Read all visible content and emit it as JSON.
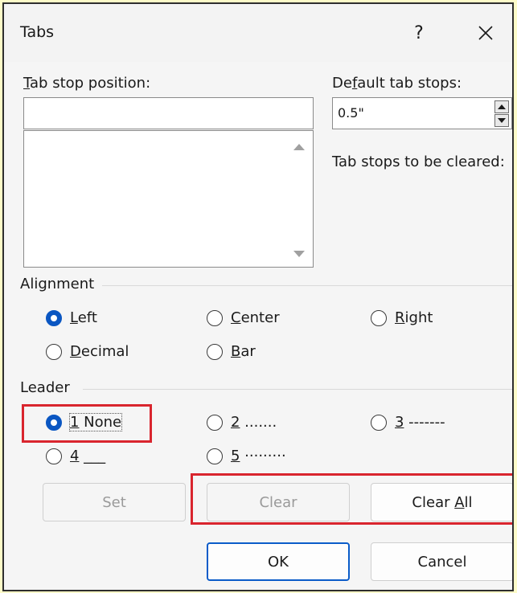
{
  "dialog": {
    "title": "Tabs",
    "help_label": "?"
  },
  "tab_stop_position": {
    "label_prefix": "T",
    "label_rest": "ab stop position:",
    "value": ""
  },
  "default_tab_stops": {
    "label_prefix": "De",
    "label_underlined": "f",
    "label_rest": "ault tab stops:",
    "value": "0.5\""
  },
  "tab_stops_to_be_cleared": {
    "label": "Tab stops to be cleared:"
  },
  "alignment": {
    "label": "Alignment",
    "options": [
      {
        "key": "L",
        "rest": "eft",
        "checked": true
      },
      {
        "key": "C",
        "rest": "enter",
        "checked": false
      },
      {
        "key": "R",
        "rest": "ight",
        "checked": false
      },
      {
        "key": "D",
        "rest": "ecimal",
        "checked": false
      },
      {
        "key": "B",
        "rest": "ar",
        "checked": false
      }
    ]
  },
  "leader": {
    "label": "Leader",
    "options": [
      {
        "key": "1",
        "rest": " None",
        "checked": true
      },
      {
        "key": "2",
        "rest": " .......",
        "checked": false
      },
      {
        "key": "3",
        "rest": " -------",
        "checked": false
      },
      {
        "key": "4",
        "rest": " ___",
        "checked": false
      },
      {
        "key": "5",
        "rest": " ·········",
        "checked": false
      }
    ]
  },
  "buttons": {
    "set": "Set",
    "clear": "Clear",
    "clear_all_prefix": "Clear ",
    "clear_all_underlined": "A",
    "clear_all_rest": "ll",
    "ok": "OK",
    "cancel": "Cancel"
  },
  "colors": {
    "highlight": "#d9252e",
    "accent": "#0a56c2",
    "page_background": "#fdfbc8"
  }
}
